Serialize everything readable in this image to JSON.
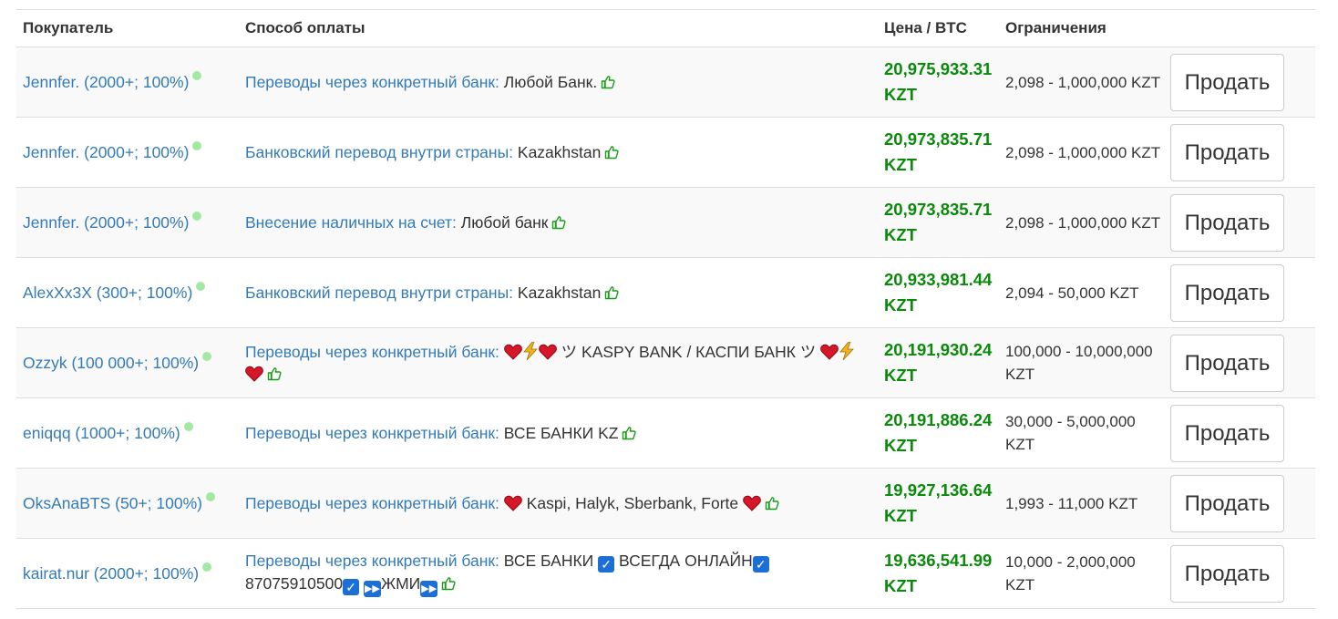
{
  "headers": {
    "buyer": "Покупатель",
    "payment": "Способ оплаты",
    "price": "Цена / BTC",
    "limits": "Ограничения"
  },
  "sell_label": "Продать",
  "rows": [
    {
      "buyer": "Jennfer. (2000+; 100%)",
      "method": "Переводы через конкретный банк:",
      "detail": "Любой Банк.",
      "price": "20,975,933.31",
      "currency": "KZT",
      "limits": "2,098 - 1,000,000 KZT"
    },
    {
      "buyer": "Jennfer. (2000+; 100%)",
      "method": "Банковский перевод внутри страны:",
      "detail": "Kazakhstan",
      "price": "20,973,835.71",
      "currency": "KZT",
      "limits": "2,098 - 1,000,000 KZT"
    },
    {
      "buyer": "Jennfer. (2000+; 100%)",
      "method": "Внесение наличных на счет:",
      "detail": "Любой банк",
      "price": "20,973,835.71",
      "currency": "KZT",
      "limits": "2,098 - 1,000,000 KZT"
    },
    {
      "buyer": "AlexXx3X (300+; 100%)",
      "method": "Банковский перевод внутри страны:",
      "detail": "Kazakhstan",
      "price": "20,933,981.44",
      "currency": "KZT",
      "limits": "2,094 - 50,000 KZT"
    },
    {
      "buyer": "Ozzyk (100 000+; 100%)",
      "method": "Переводы через конкретный банк:",
      "detail": "ツ KASPY BANK / КАСПИ БАНК ツ",
      "price": "20,191,930.24",
      "currency": "KZT",
      "limits": "100,000 - 10,000,000 KZT"
    },
    {
      "buyer": "eniqqq (1000+; 100%)",
      "method": "Переводы через конкретный банк:",
      "detail": "ВСЕ БАНКИ KZ",
      "price": "20,191,886.24",
      "currency": "KZT",
      "limits": "30,000 - 5,000,000 KZT"
    },
    {
      "buyer": "OksAnaBTS (50+; 100%)",
      "method": "Переводы через конкретный банк:",
      "detail": "Kaspi, Halyk, Sberbank, Forte",
      "price": "19,927,136.64",
      "currency": "KZT",
      "limits": "1,993 - 11,000 KZT"
    },
    {
      "buyer": "kairat.nur (2000+; 100%)",
      "method": "Переводы через конкретный банк:",
      "detail_a": "ВСЕ БАНКИ",
      "detail_b": "ВСЕГДА ОНЛАЙН",
      "detail_c": "87075910500",
      "detail_d": "ЖМИ",
      "price": "19,636,541.99",
      "currency": "KZT",
      "limits": "10,000 - 2,000,000 KZT"
    }
  ],
  "colors": {
    "link": "#337ab7",
    "price": "#0a8a0a",
    "online_dot": "#a3e8a3"
  },
  "icons": [
    "thumbs-up-icon",
    "heart-icon",
    "lightning-icon",
    "checkbox-icon",
    "fast-forward-icon",
    "online-dot-icon"
  ]
}
